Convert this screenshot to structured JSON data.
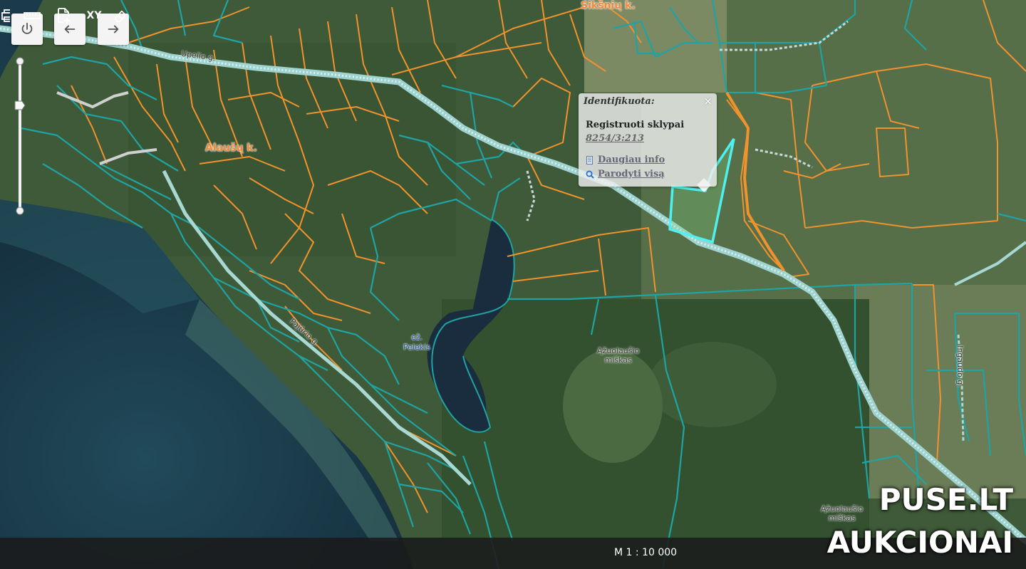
{
  "toolbar_top": {
    "power_icon": "power-icon",
    "back_icon": "arrow-left-icon",
    "forward_icon": "arrow-right-icon"
  },
  "popup": {
    "title": "Identifikuota:",
    "close": "×",
    "layer": "Registruoti sklypai",
    "parcel_id": "8254/3:213",
    "more_info": "Daugiau info",
    "show_all": "Parodyti visą"
  },
  "labels": {
    "alausu": "Alaušų k.",
    "siksniu": "Sikšnių k.",
    "lake": "ež.\nPelekis",
    "forest1": "Ąžuolaušio\nmiškas",
    "forest2": "Ąžuolaušio\nmiškas",
    "road_upelio": "Upelio g.",
    "road_pajurio": "Pajūrio g.",
    "road_ingaudo": "Ingaudo g."
  },
  "bottom": {
    "scale": "M 1 : 10 000",
    "xy_label": "XY"
  },
  "watermark": {
    "line1": "PUSE.LT",
    "line2": "AUKCIONAI"
  },
  "colors": {
    "parcel_orange": "#f0922e",
    "parcel_teal": "#1fa3a3",
    "selected": "#4ef0f0",
    "water": "#17323f"
  }
}
